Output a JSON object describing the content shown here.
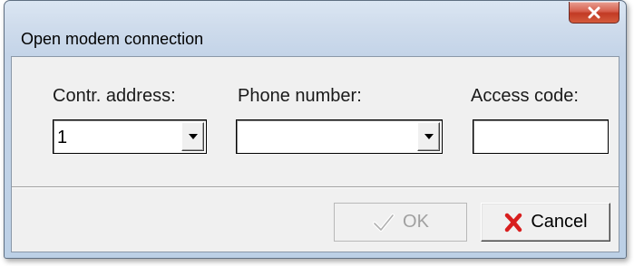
{
  "window": {
    "title": "Open modem connection"
  },
  "fields": {
    "address_label": "Contr. address:",
    "address_value": "1",
    "phone_label": "Phone number:",
    "phone_value": "",
    "access_label": "Access code:",
    "access_value": ""
  },
  "buttons": {
    "ok_label": "OK",
    "ok_enabled": false,
    "cancel_label": "Cancel"
  },
  "icons": {
    "close": "close-icon",
    "ok": "checkmark-icon",
    "cancel": "red-x-icon"
  },
  "colors": {
    "close_button": "#c23a24",
    "cancel_icon": "#d81e1e",
    "disabled_text": "#a0a0a0"
  }
}
